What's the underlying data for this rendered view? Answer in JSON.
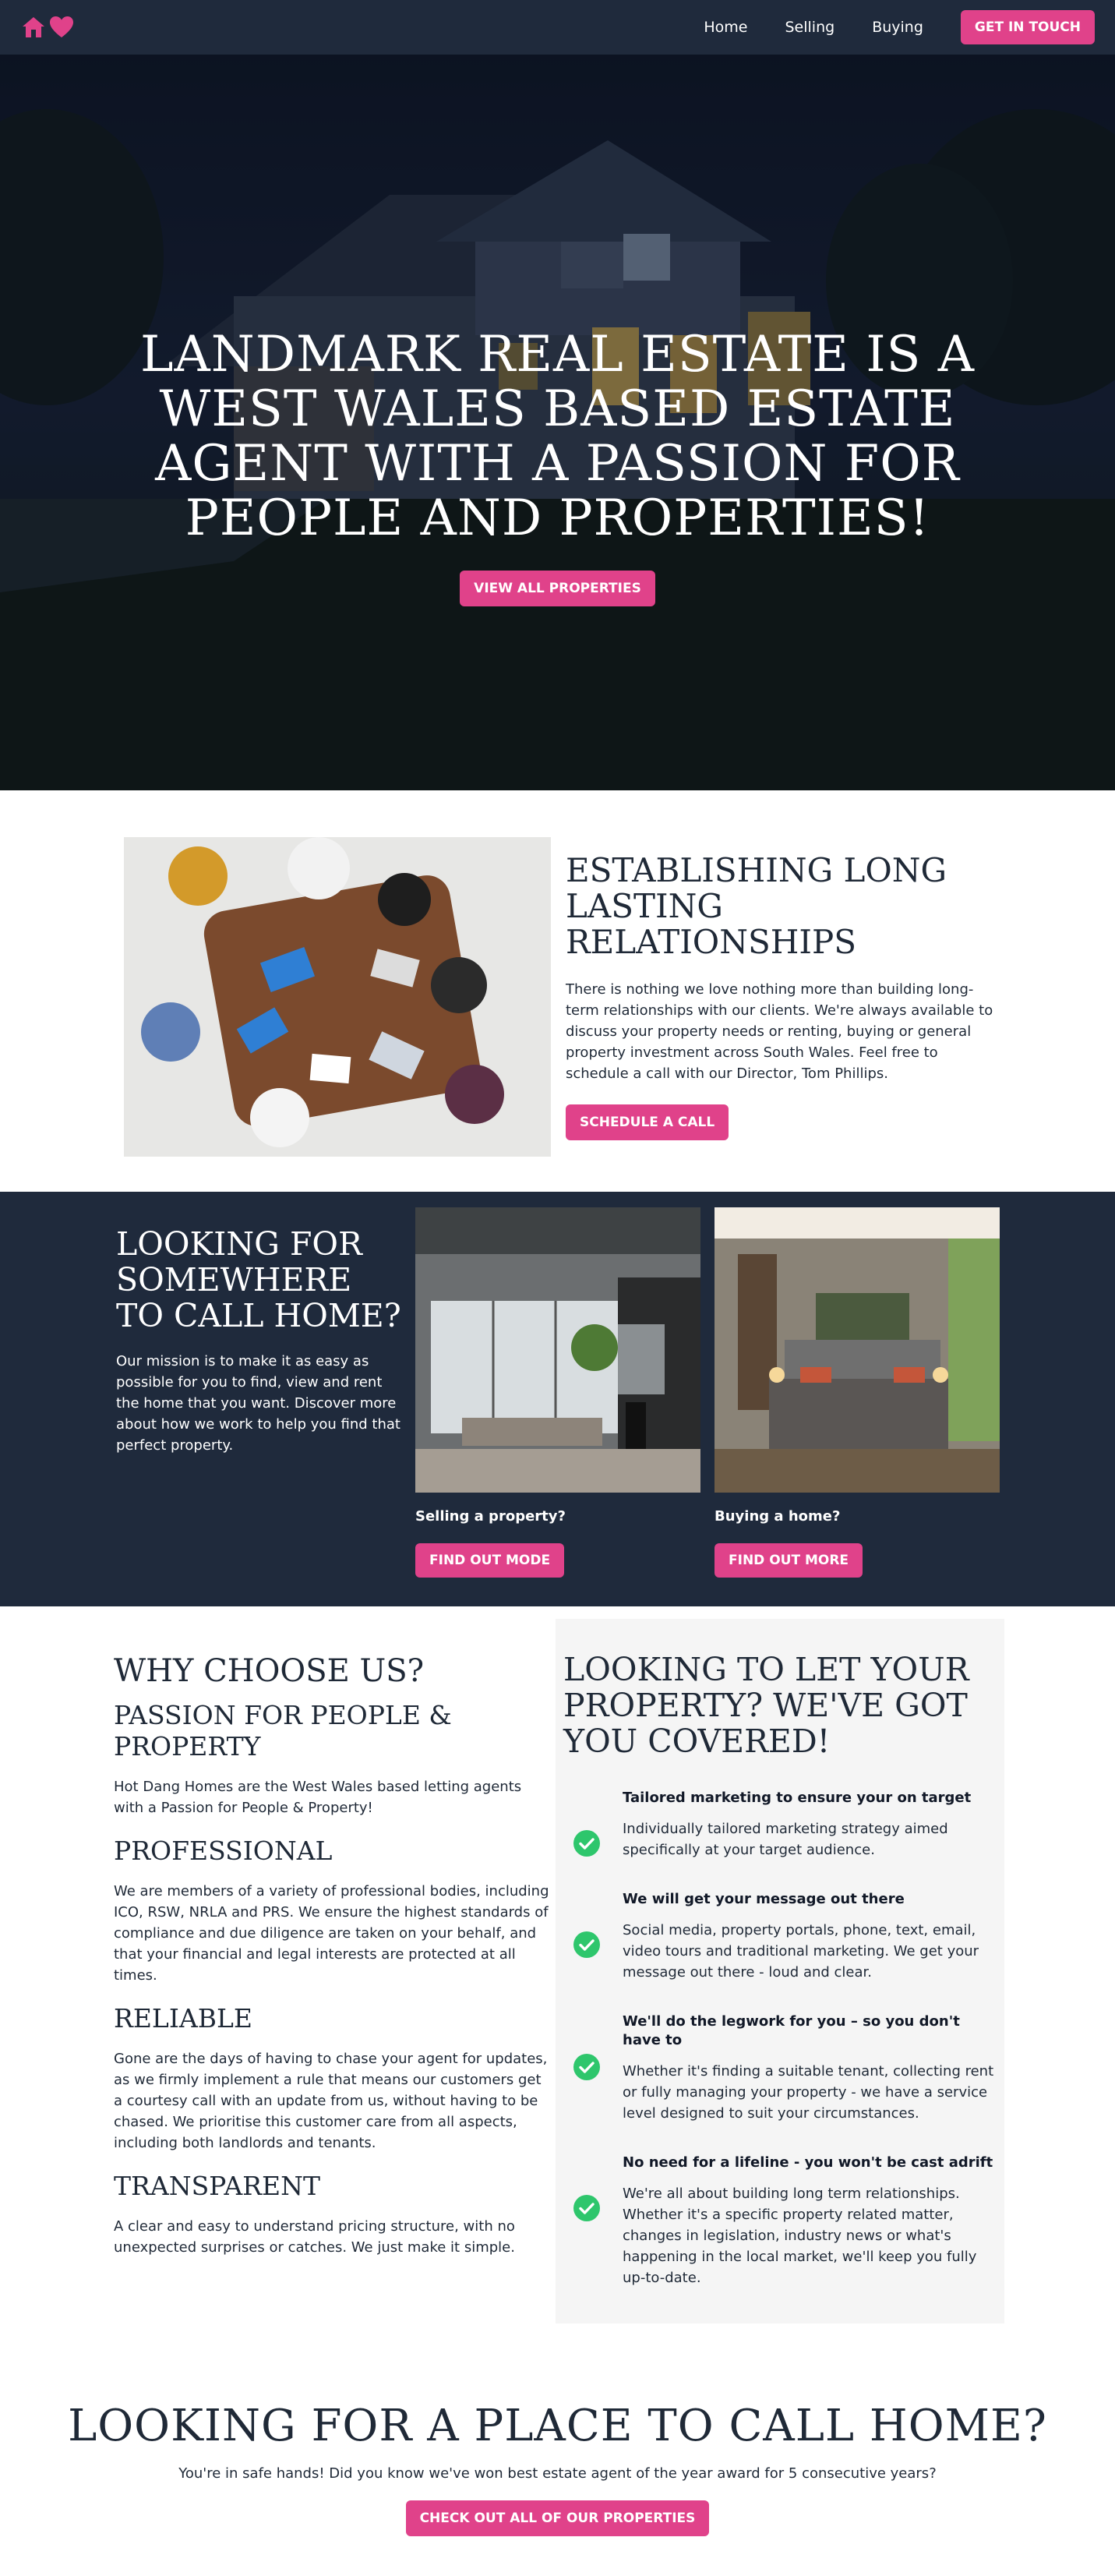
{
  "nav": {
    "links": [
      "Home",
      "Selling",
      "Buying"
    ],
    "cta": "GET IN TOUCH",
    "logo_icons": [
      "house-icon",
      "heart-icon"
    ],
    "bg_color": "#1f2a3c"
  },
  "hero": {
    "title": "LANDMARK REAL ESTATE IS A WEST WALES BASED ESTATE AGENT WITH A PASSION FOR PEOPLE AND PROPERTIES!",
    "cta": "VIEW ALL PROPERTIES"
  },
  "relationships": {
    "heading": "ESTABLISHING LONG LASTING RELATIONSHIPS",
    "body": "There is nothing we love nothing more than building long-term relationships with our clients. We're always available to discuss your property needs or renting, buying or general property investment across South Wales. Feel free to schedule a call with our Director, Tom Phillips.",
    "cta": "SCHEDULE A CALL"
  },
  "home": {
    "heading": "LOOKING FOR SOMEWHERE TO CALL HOME?",
    "body": "Our mission is to make it as easy as possible for you to find, view and rent the home that you want. Discover more about how we work to help you find that perfect property.",
    "cards": [
      {
        "label": "Selling a property?",
        "cta": "FIND OUT MODE"
      },
      {
        "label": "Buying a home?",
        "cta": "FIND OUT MORE"
      }
    ]
  },
  "why": {
    "title": "WHY CHOOSE US?",
    "subtitle": "PASSION FOR PEOPLE & PROPERTY",
    "intro": "Hot Dang Homes are the West Wales based letting agents with a Passion for People & Property!",
    "items": [
      {
        "title": "PROFESSIONAL",
        "text": "We are members of a variety of professional bodies, including ICO, RSW, NRLA and PRS. We ensure the highest standards of compliance and due diligence are taken on your behalf, and that your financial and legal interests are protected at all times."
      },
      {
        "title": "RELIABLE",
        "text": "Gone are the days of having to chase your agent for updates, as we firmly implement a rule that means our customers get a courtesy call with an update from us, without having to be chased. We prioritise this customer care from all aspects, including both landlords and tenants."
      },
      {
        "title": "TRANSPARENT",
        "text": "A clear and easy to understand pricing structure, with no unexpected surprises or catches. We just make it simple."
      }
    ]
  },
  "letting": {
    "heading": "LOOKING TO LET YOUR PROPERTY? WE'VE GOT YOU COVERED!",
    "items": [
      {
        "title": "Tailored marketing to ensure your on target",
        "text": "Individually tailored marketing strategy aimed specifically at your target audience."
      },
      {
        "title": "We will get your message out there",
        "text": "Social media, property portals, phone, text, email, video tours and traditional marketing. We get your message out there - loud and clear."
      },
      {
        "title": "We'll do the legwork for you – so you don't have to",
        "text": "Whether it's finding a suitable tenant, collecting rent or fully managing your property - we have a service level designed to suit your circumstances."
      },
      {
        "title": "No need for a lifeline - you won't be cast adrift",
        "text": "We're all about building long term relationships. Whether it's a specific property related matter, changes in legislation, industry news or what's happening in the local market, we'll keep you fully up-to-date."
      }
    ]
  },
  "cta_section": {
    "heading": "LOOKING FOR A PLACE TO CALL HOME?",
    "body": "You're in safe hands! Did you know we've won best estate agent of the year award for 5 consecutive years?",
    "cta": "CHECK OUT ALL OF OUR PROPERTIES"
  },
  "colors": {
    "accent": "#e0428a",
    "navy": "#1f2a3c",
    "check_green": "#2ec66c",
    "panel_grey": "#f5f5f5"
  }
}
